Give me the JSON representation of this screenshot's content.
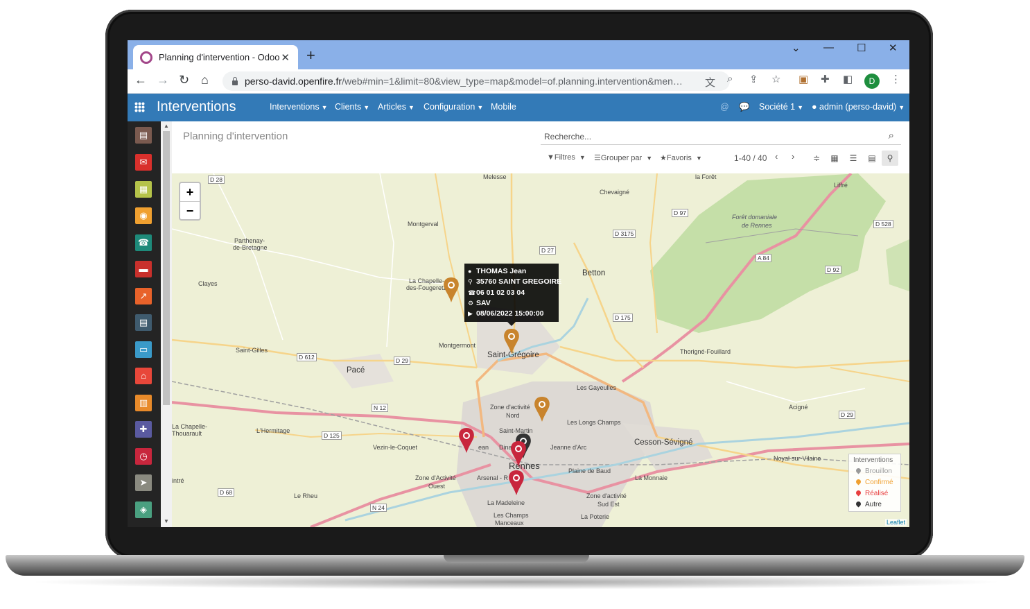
{
  "browser": {
    "tab_title": "Planning d'intervention - Odoo",
    "url_domain": "perso-david.openfire.fr",
    "url_path": "/web#min=1&limit=80&view_type=map&model=of.planning.intervention&men…",
    "profile_initial": "D"
  },
  "odoo": {
    "app_title": "Interventions",
    "menu": [
      "Interventions",
      "Clients",
      "Articles",
      "Configuration",
      "Mobile"
    ],
    "company": "Société 1",
    "user": "admin (perso-david)"
  },
  "control_panel": {
    "title": "Planning d'intervention",
    "search_placeholder": "Recherche...",
    "filters_label": "Filtres",
    "groupby_label": "Grouper par",
    "favorites_label": "Favoris",
    "pager": "1-40 / 40"
  },
  "map": {
    "zoom_in": "+",
    "zoom_out": "−",
    "attribution": "Leaflet",
    "labels": {
      "melesse": "Melesse",
      "chevaigne": "Chevaigné",
      "la_foret": "la Forêt",
      "liffre": "Liffré",
      "foret_domaniale": "Forêt domaniale",
      "de_rennes": "de Rennes",
      "montgerval": "Montgerval",
      "parthenay": "Parthenay-",
      "de_bretagne": "de-Bretagne",
      "clayes": "Clayes",
      "la_chapelle_foug": "La Chapelle-",
      "des_fougeretz": "des-Fougeretz",
      "betton": "Betton",
      "montgermont": "Montgermont",
      "saint_gregoire": "Saint-Grégoire",
      "saint_gilles": "Saint-Gilles",
      "pace": "Pacé",
      "thorigne": "Thorigné-Fouillard",
      "les_gayeulles": "Les Gayeulles",
      "zone_activite_nord_1": "Zone d'activité",
      "nord": "Nord",
      "acigne": "Acigné",
      "les_longs_champs": "Les Longs Champs",
      "la_chapelle_thou": "La Chapelle-",
      "thouarault": "Thouarault",
      "l_hermitage": "L'Hermitage",
      "vezin": "Vezin-le-Coquet",
      "saint_martin": "Saint-Martin",
      "jeanne_arc": "Jeanne d'Arc",
      "cesson": "Cesson-Sévigné",
      "noyal": "Noyal-sur-Vilaine",
      "rennes": "Rennes",
      "plaine_baud": "Plaine de Baud",
      "la_monnaie": "La Monnaie",
      "zone_activite_ouest": "Zone d'Activité",
      "ouest": "Ouest",
      "arsenal": "Arsenal - R",
      "le_rheu": "Le Rheu",
      "zone_activite_sud_est": "Zone d'activité",
      "sud_est": "Sud Est",
      "la_madeleine": "La Madeleine",
      "les_champs": "Les Champs",
      "manceaux": "Manceaux",
      "la_poterie": "La Poterie",
      "intre": "intré",
      "dinan": "Dinan",
      "ean": "ean"
    },
    "roads": [
      "D 28",
      "D 97",
      "D 3175",
      "D 528",
      "D 27",
      "A 84",
      "D 92",
      "D 175",
      "D 612",
      "D 29",
      "N 12",
      "D 125",
      "D 68",
      "N 24",
      "D 29"
    ],
    "tooltip": {
      "name": "THOMAS Jean",
      "address": "35760 SAINT GREGOIRE",
      "phone": "06 01 02 03 04",
      "type": "SAV",
      "date": "08/06/2022 15:00:00"
    },
    "legend": {
      "title": "Interventions",
      "items": [
        {
          "label": "Brouillon",
          "color": "#999999"
        },
        {
          "label": "Confirmé",
          "color": "#f0a030"
        },
        {
          "label": "Réalisé",
          "color": "#e83e3e"
        },
        {
          "label": "Autre",
          "color": "#333333"
        }
      ]
    },
    "marker_colors": {
      "orange": "#c8842d",
      "red": "#c8263d",
      "dark": "#333333"
    }
  }
}
